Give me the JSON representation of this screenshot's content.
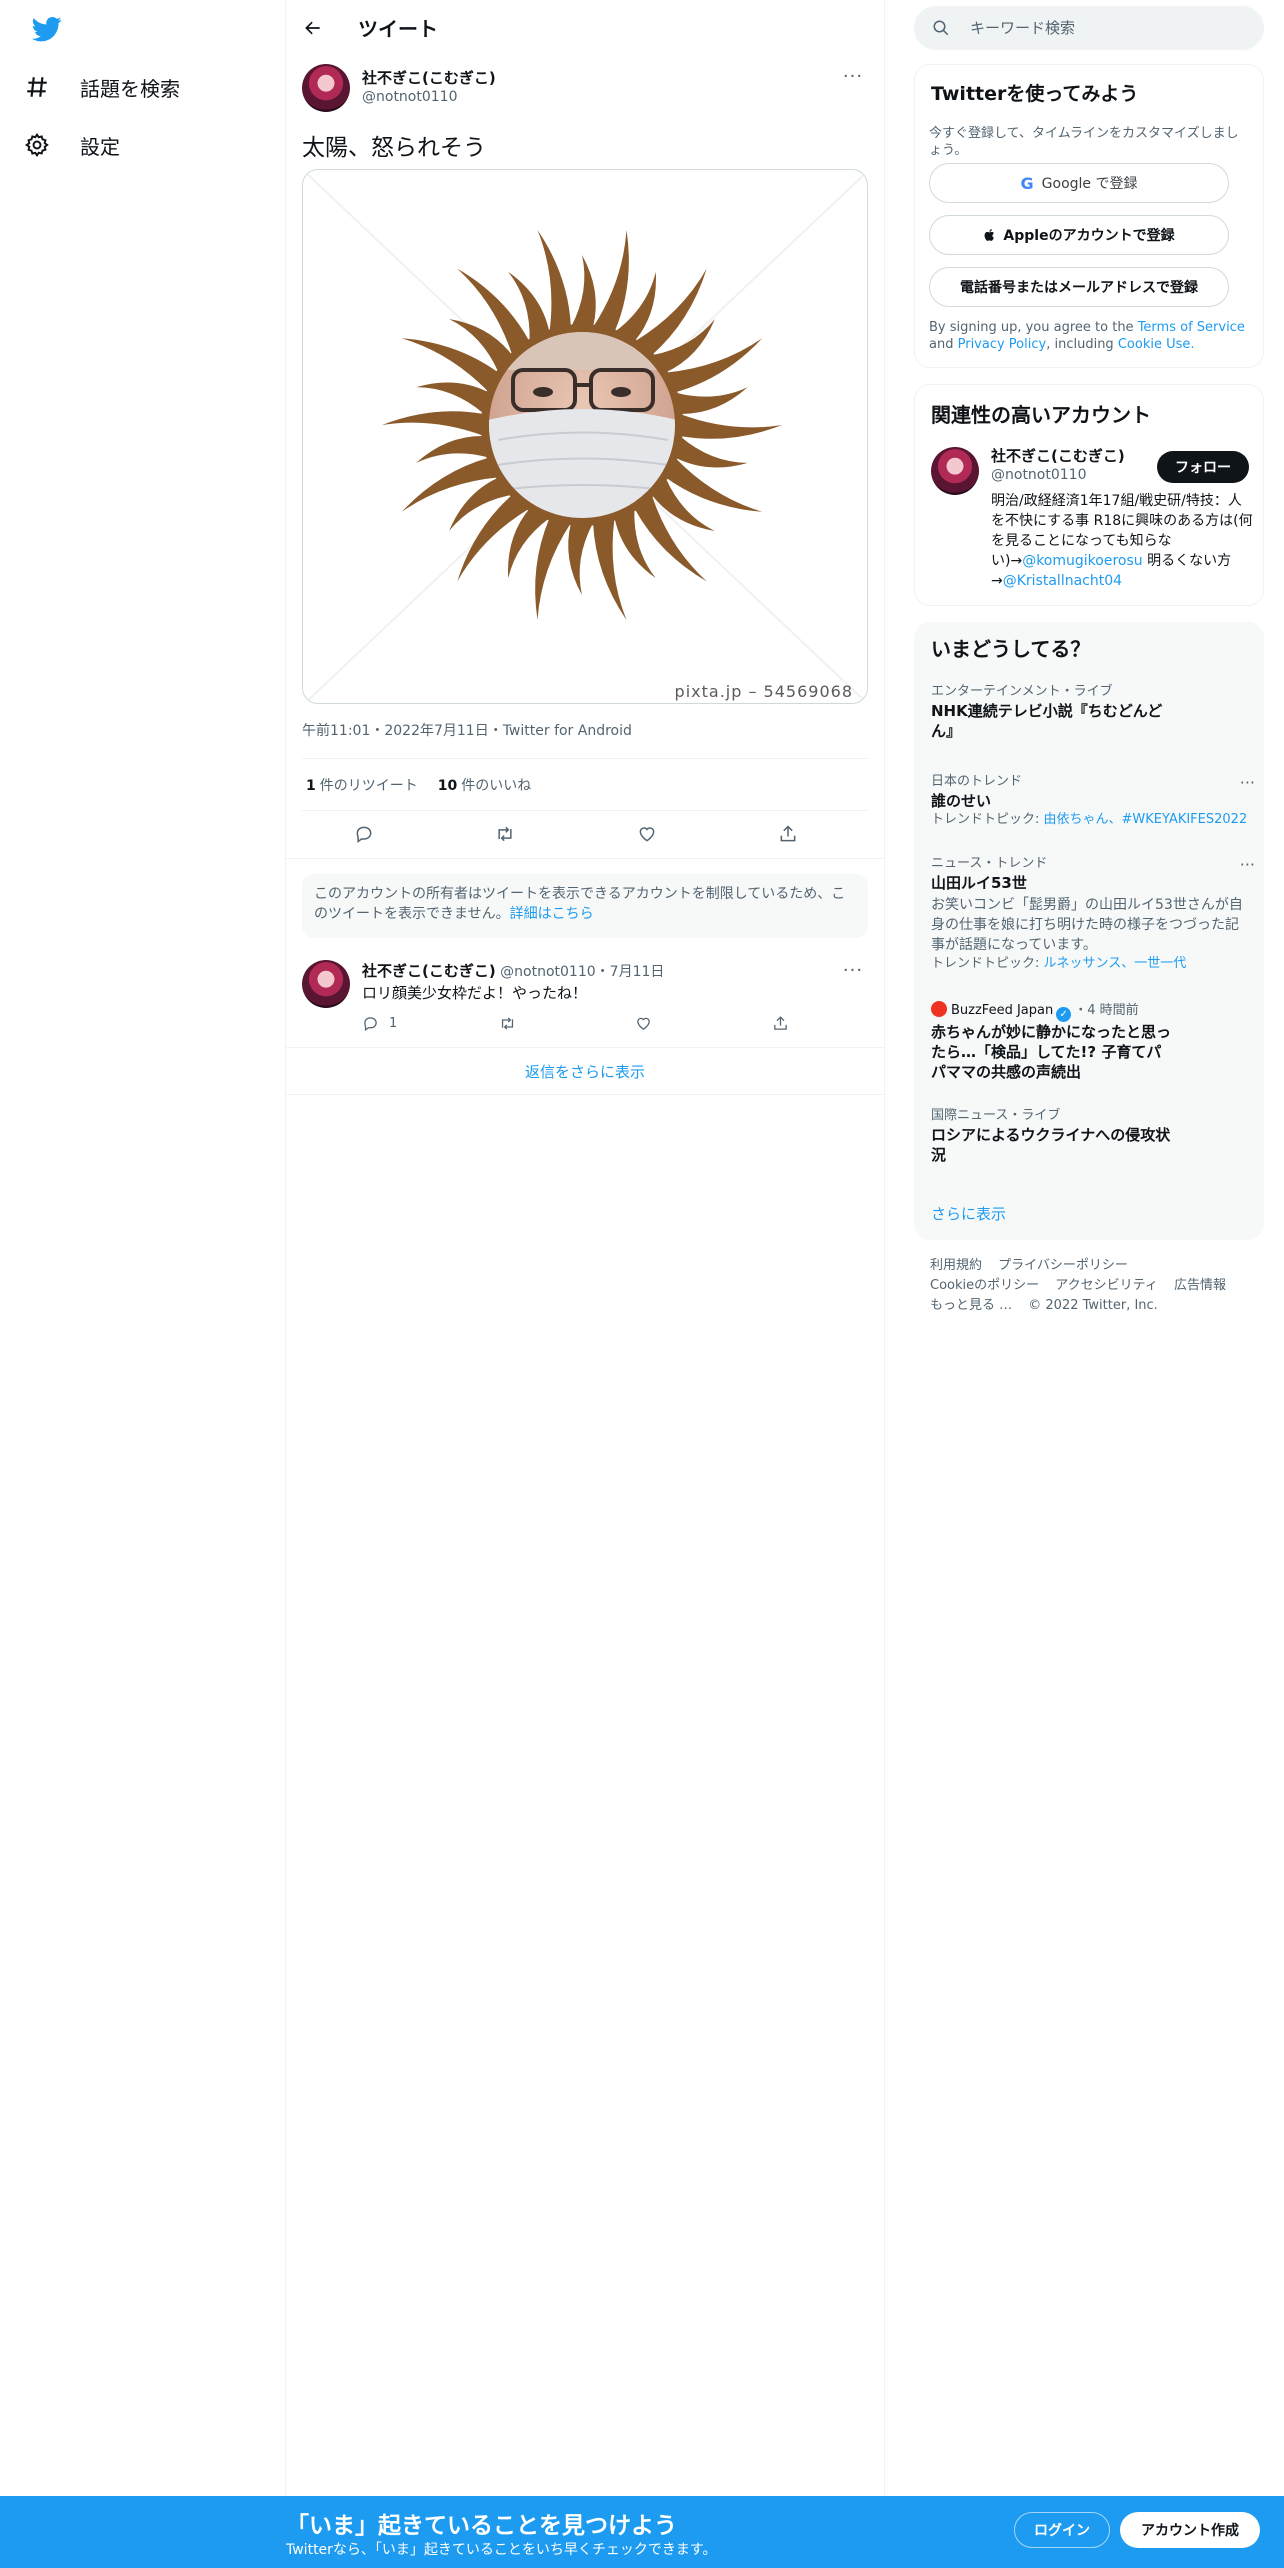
{
  "nav": {
    "explore": "話題を検索",
    "settings": "設定"
  },
  "header": {
    "title": "ツイート"
  },
  "tweet": {
    "author_name": "社不ぎこ(こむぎこ)",
    "author_handle": "@notnot0110",
    "more": "···",
    "text": "太陽、怒られそう",
    "image_watermark": "pixta.jp – 54569068",
    "meta": "午前11:01・2022年7月11日・Twitter for Android",
    "retweets_count": "1",
    "retweets_label": "件のリツイート",
    "likes_count": "10",
    "likes_label": "件のいいね"
  },
  "notice": {
    "text": "このアカウントの所有者はツイートを表示できるアカウントを制限しているため、このツイートを表示できません。",
    "link": "詳細はこちら"
  },
  "reply": {
    "author_name": "社不ぎこ(こむぎこ)",
    "author_handle": "@notnot0110",
    "date": "・7月11日",
    "more": "···",
    "text": "ロリ顔美少女枠だよ！やったね！",
    "reply_count": "1"
  },
  "show_more_replies": "返信をさらに表示",
  "search": {
    "placeholder": "キーワード検索"
  },
  "signup_card": {
    "title": "Twitterを使ってみよう",
    "subtitle": "今すぐ登録して、タイムラインをカスタマイズしましょう。",
    "google_label": "Google で登録",
    "apple_label": "Appleのアカウントで登録",
    "phone_label": "電話番号またはメールアドレスで登録",
    "terms_pre": "By signing up, you agree to the",
    "terms_tos": "Terms of Service",
    "terms_and": "and",
    "terms_privacy": "Privacy Policy",
    "terms_including": ", including",
    "terms_cookie": "Cookie Use."
  },
  "related": {
    "title": "関連性の高いアカウント",
    "name": "社不ぎこ(こむぎこ)",
    "handle": "@notnot0110",
    "follow_label": "フォロー",
    "bio_text": "明治/政経経済1年17組/戦史研/特技：人を不快にする事 R18に興味のある方は(何を見ることになっても知らない)→",
    "bio_link1": "@komugikoerosu",
    "bio_mid": " 明るくない方→",
    "bio_link2": "@Kristallnacht04"
  },
  "trends": {
    "title": "いまどうしてる？",
    "items": [
      {
        "category": "エンターテインメント・ライブ",
        "title": "NHK連続テレビ小説『ちむどんどん』"
      },
      {
        "category": "日本のトレンド",
        "title": "誰のせい",
        "topic_prefix": "トレンドトピック: ",
        "topic_link": "由依ちゃん、#WKEYAKIFES2022"
      },
      {
        "category": "ニュース・トレンド",
        "title": "山田ルイ53世",
        "desc": "お笑いコンビ「髭男爵」の山田ルイ53世さんが自身の仕事を娘に打ち明けた時の様子をつづった記事が話題になっています。",
        "topic_prefix": "トレンドトピック: ",
        "topic_link": "ルネッサンス、一世一代"
      },
      {
        "source": "BuzzFeed Japan",
        "time": "・4 時間前",
        "title": "赤ちゃんが妙に静かになったと思ったら…「検品」してた!? 子育てパパママの共感の声続出"
      },
      {
        "category": "国際ニュース・ライブ",
        "title": "ロシアによるウクライナへの侵攻状況"
      }
    ],
    "show_more": "さらに表示"
  },
  "footer": {
    "terms": "利用規約",
    "privacy": "プライバシーポリシー",
    "cookie": "Cookieのポリシー",
    "accessibility": "アクセシビリティ",
    "ads": "広告情報",
    "more": "もっと見る …",
    "copyright": "© 2022 Twitter, Inc."
  },
  "banner": {
    "title": "「いま」起きていることを見つけよう",
    "subtitle": "Twitterなら、「いま」起きていることをいち早くチェックできます。",
    "login": "ログイン",
    "signup": "アカウント作成"
  },
  "colors": {
    "accent": "#1d9bf0",
    "text": "#0f1419",
    "secondary": "#536471"
  }
}
